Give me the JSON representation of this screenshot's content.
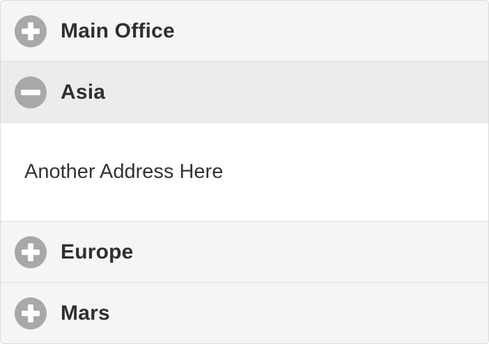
{
  "accordion": {
    "sections": [
      {
        "title": "Main Office",
        "icon": "plus-circle-icon",
        "expanded": false
      },
      {
        "title": "Asia",
        "icon": "minus-circle-icon",
        "expanded": true,
        "content": "Another Address Here"
      },
      {
        "title": "Europe",
        "icon": "plus-circle-icon",
        "expanded": false
      },
      {
        "title": "Mars",
        "icon": "plus-circle-icon",
        "expanded": false
      }
    ]
  },
  "colors": {
    "icon": "#a8a8a8",
    "header_bg": "#f5f5f5",
    "header_open_bg": "#ececec",
    "body_bg": "#ffffff",
    "text": "#2f2f2f"
  }
}
